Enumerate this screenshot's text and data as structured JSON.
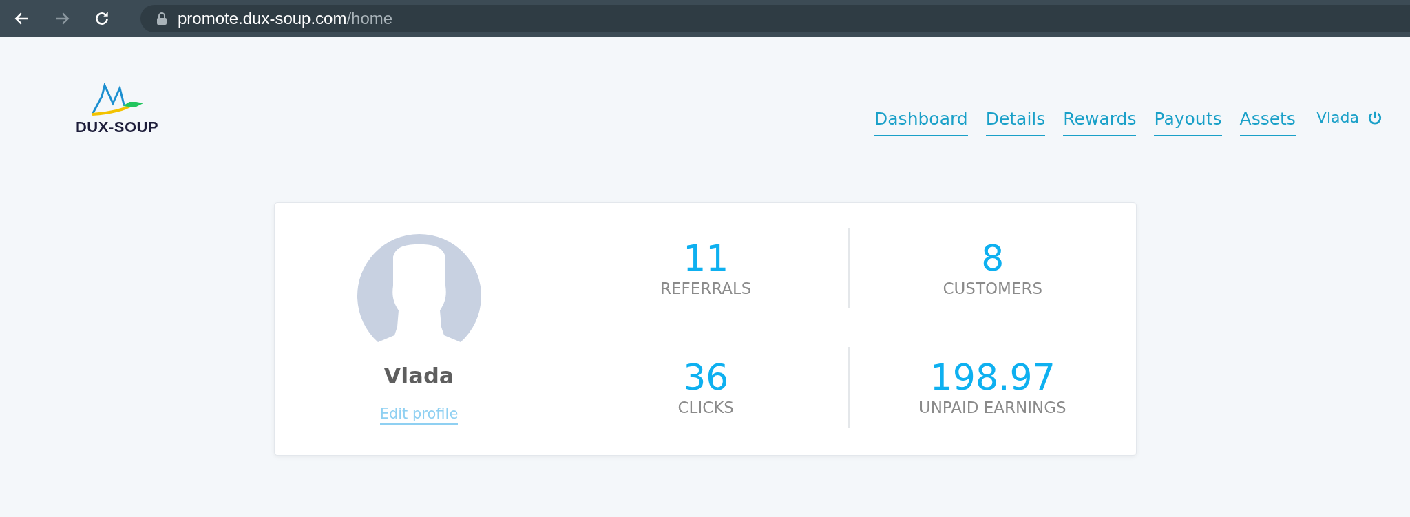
{
  "browser": {
    "url_host": "promote.dux-soup.com",
    "url_path": "/home",
    "forward_disabled": true
  },
  "logo": {
    "text": "DUX-SOUP"
  },
  "nav": {
    "items": [
      {
        "label": "Dashboard"
      },
      {
        "label": "Details"
      },
      {
        "label": "Rewards"
      },
      {
        "label": "Payouts"
      },
      {
        "label": "Assets"
      }
    ],
    "user": "Vlada"
  },
  "profile": {
    "name": "Vlada",
    "edit_link": "Edit profile"
  },
  "stats": [
    {
      "value": "11",
      "label": "REFERRALS"
    },
    {
      "value": "8",
      "label": "CUSTOMERS"
    },
    {
      "value": "36",
      "label": "CLICKS"
    },
    {
      "value": "198.97",
      "label": "UNPAID EARNINGS"
    }
  ]
}
